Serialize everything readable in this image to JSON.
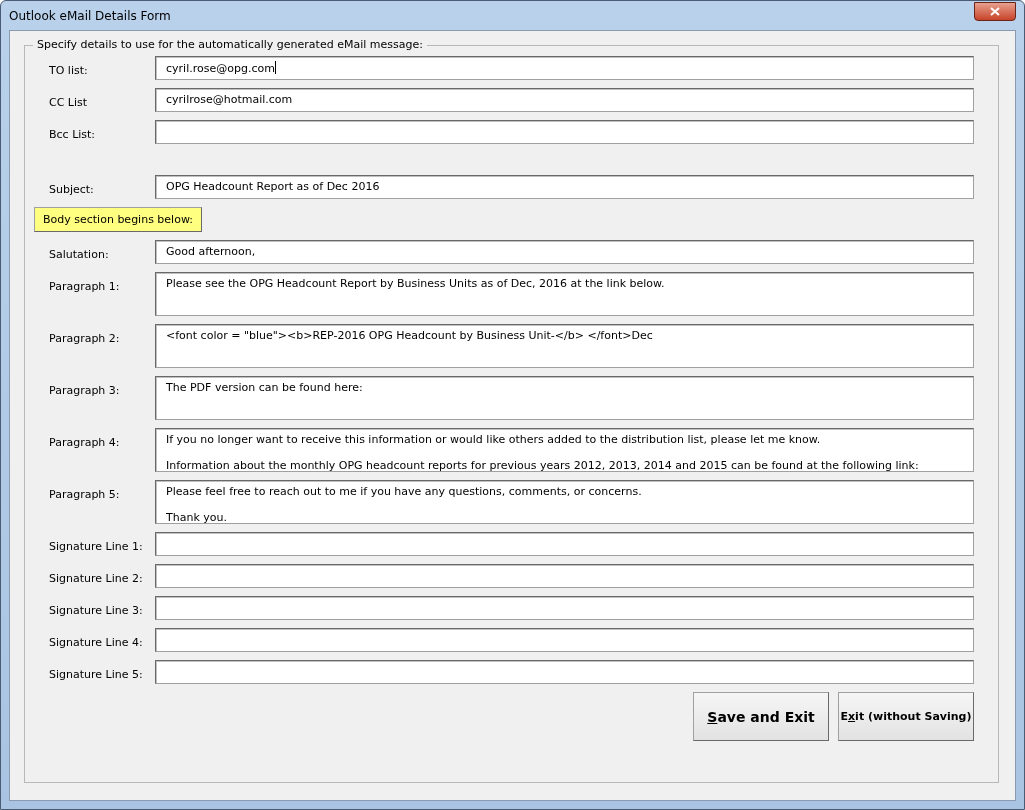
{
  "window": {
    "title": "Outlook eMail Details Form"
  },
  "group": {
    "caption": "Specify details to use for the automatically generated eMail message:"
  },
  "fields": [
    {
      "kind": "single",
      "label": "TO list:",
      "value": "cyril.rose@opg.com",
      "focused": true
    },
    {
      "kind": "single",
      "label": "CC List",
      "value": "cyrilrose@hotmail.com",
      "focused": false
    },
    {
      "kind": "single",
      "label": "Bcc List:",
      "focused": false
    },
    {
      "kind": "spacer"
    },
    {
      "kind": "single",
      "label": "Subject:",
      "value": "OPG Headcount Report as of Dec 2016",
      "focused": false
    },
    {
      "kind": "banner",
      "label": "Body section begins below:"
    },
    {
      "kind": "single",
      "label": "Salutation:",
      "value": "Good afternoon,",
      "focused": false
    },
    {
      "kind": "multi",
      "label": "Paragraph 1:",
      "value": "Please see the OPG Headcount Report by Business Units as of Dec, 2016 at the link below.",
      "focused": false
    },
    {
      "kind": "multi",
      "label": "Paragraph 2:",
      "value": "<font color = \"blue\"><b>REP-2016 OPG Headcount by Business Unit-</b> </font>Dec",
      "focused": false
    },
    {
      "kind": "multi",
      "label": "Paragraph 3:",
      "value": "The PDF version can be found here:",
      "focused": false
    },
    {
      "kind": "multi",
      "label": "Paragraph 4:",
      "value": "If you no longer want to receive this information or would like others added to the distribution list, please let me know.\n\nInformation about the monthly OPG headcount reports for previous years 2012, 2013, 2014 and 2015 can be found at the following link:",
      "focused": false
    },
    {
      "kind": "multi",
      "label": "Paragraph 5:",
      "value": "Please feel free to reach out to me if you have any questions, comments, or concerns.\n\nThank you.",
      "focused": false
    },
    {
      "kind": "single",
      "label": "Signature Line 1:",
      "focused": false
    },
    {
      "kind": "single",
      "label": "Signature Line 2:",
      "focused": false
    },
    {
      "kind": "single",
      "label": "Signature Line 3:",
      "focused": false
    },
    {
      "kind": "single",
      "label": "Signature Line 4:",
      "focused": false
    },
    {
      "kind": "single",
      "label": "Signature Line 5:",
      "focused": false
    }
  ],
  "buttons": [
    {
      "kind": "large",
      "key": "S",
      "after": "ave and Exit"
    },
    {
      "kind": "small",
      "before": "E",
      "key": "x",
      "after": "it (without Saving)"
    }
  ]
}
